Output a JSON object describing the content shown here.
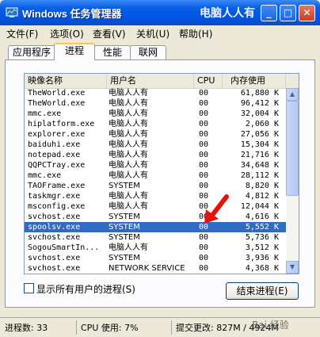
{
  "window": {
    "title": "Windows 任务管理器",
    "watermark": "电脑人人有",
    "controls": {
      "minimize": "_",
      "maximize": "□",
      "close": "✕"
    }
  },
  "menu": [
    "文件(F)",
    "选项(O)",
    "查看(V)",
    "关机(U)",
    "帮助(H)"
  ],
  "tabs": [
    {
      "label": "应用程序",
      "active": false
    },
    {
      "label": "进程",
      "active": true
    },
    {
      "label": "性能",
      "active": false
    },
    {
      "label": "联网",
      "active": false
    }
  ],
  "table": {
    "headers": [
      "映像名称",
      "用户名",
      "CPU",
      "内存使用"
    ],
    "rows": [
      {
        "name": "TheWorld.exe",
        "user": "电脑人人有",
        "cpu": "00",
        "mem": "61,880 K"
      },
      {
        "name": "TheWorld.exe",
        "user": "电脑人人有",
        "cpu": "00",
        "mem": "96,412 K"
      },
      {
        "name": "mmc.exe",
        "user": "电脑人人有",
        "cpu": "00",
        "mem": "32,004 K"
      },
      {
        "name": "hiplatform.exe",
        "user": "电脑人人有",
        "cpu": "00",
        "mem": "2,060 K"
      },
      {
        "name": "explorer.exe",
        "user": "电脑人人有",
        "cpu": "00",
        "mem": "27,056 K"
      },
      {
        "name": "baiduhi.exe",
        "user": "电脑人人有",
        "cpu": "00",
        "mem": "15,304 K"
      },
      {
        "name": "notepad.exe",
        "user": "电脑人人有",
        "cpu": "00",
        "mem": "21,716 K"
      },
      {
        "name": "QQPCTray.exe",
        "user": "电脑人人有",
        "cpu": "00",
        "mem": "34,648 K"
      },
      {
        "name": "mmc.exe",
        "user": "电脑人人有",
        "cpu": "00",
        "mem": "28,112 K"
      },
      {
        "name": "TAOFrame.exe",
        "user": "SYSTEM",
        "cpu": "00",
        "mem": "8,820 K"
      },
      {
        "name": "taskmgr.exe",
        "user": "电脑人人有",
        "cpu": "00",
        "mem": "4,812 K"
      },
      {
        "name": "msconfig.exe",
        "user": "电脑人人有",
        "cpu": "00",
        "mem": "12,044 K"
      },
      {
        "name": "svchost.exe",
        "user": "SYSTEM",
        "cpu": "00",
        "mem": "4,616 K"
      },
      {
        "name": "spoolsv.exe",
        "user": "SYSTEM",
        "cpu": "00",
        "mem": "5,552 K",
        "selected": true
      },
      {
        "name": "svchost.exe",
        "user": "SYSTEM",
        "cpu": "00",
        "mem": "5,736 K"
      },
      {
        "name": "SogouSmartIn...",
        "user": "电脑人人有",
        "cpu": "00",
        "mem": "3,512 K"
      },
      {
        "name": "svchost.exe",
        "user": "SYSTEM",
        "cpu": "00",
        "mem": "3,936 K"
      },
      {
        "name": "svchost.exe",
        "user": "NETWORK SERVICE",
        "cpu": "00",
        "mem": "4,368 K"
      }
    ]
  },
  "show_all_users_label": "显示所有用户的进程(S)",
  "end_process_label": "结束进程(E)",
  "status": {
    "processes": "进程数: 33",
    "cpu": "CPU 使用: 7%",
    "commit": "提交更改: 827M / 4924M"
  },
  "bottom_watermark": "Bai 经验",
  "colors": {
    "selection": "#316AC5",
    "titlebar": "#0054E3",
    "arrow": "#E8120C"
  }
}
